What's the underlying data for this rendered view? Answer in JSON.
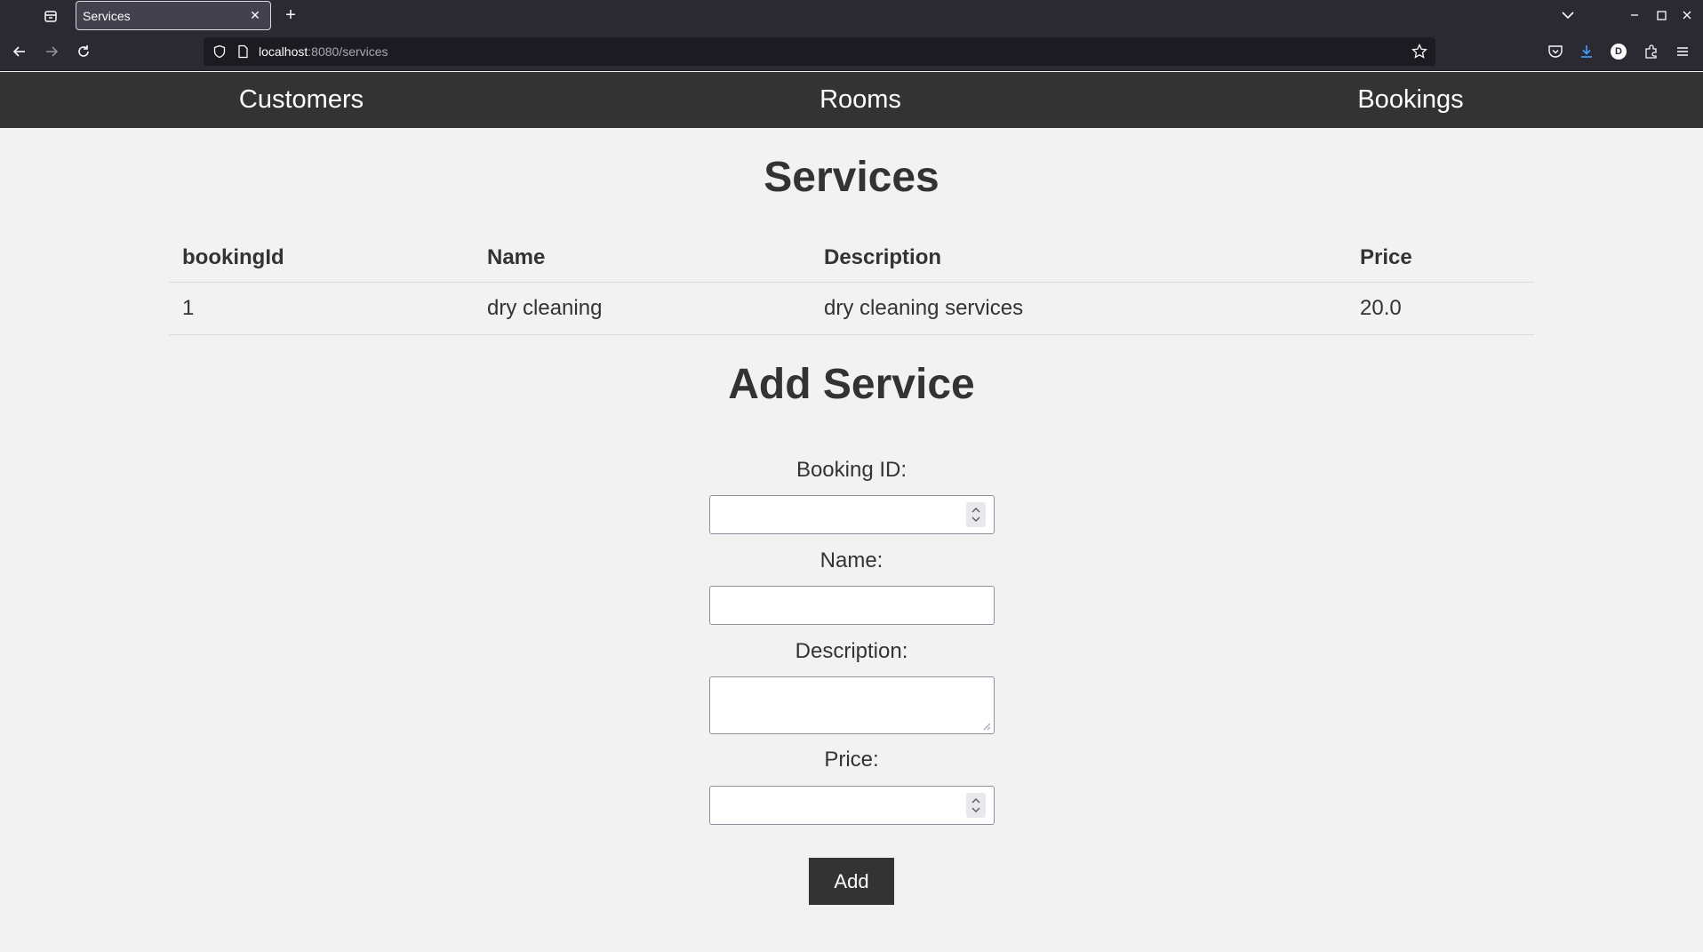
{
  "browser": {
    "tab_title": "Services",
    "url_host": "localhost",
    "url_rest": ":8080/services",
    "profile_initial": "D"
  },
  "site_nav": {
    "items": [
      "Customers",
      "Rooms",
      "Bookings"
    ]
  },
  "page_title": "Services",
  "table": {
    "headers": [
      "bookingId",
      "Name",
      "Description",
      "Price"
    ],
    "rows": [
      [
        "1",
        "dry cleaning",
        "dry cleaning services",
        "20.0"
      ]
    ]
  },
  "form": {
    "title": "Add Service",
    "booking_id_label": "Booking ID:",
    "name_label": "Name:",
    "description_label": "Description:",
    "price_label": "Price:",
    "submit_label": "Add"
  }
}
